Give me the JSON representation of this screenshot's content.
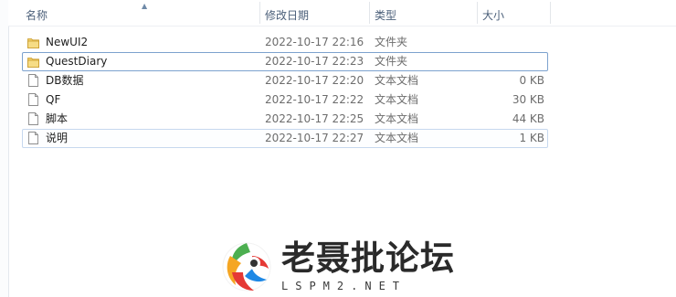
{
  "header": {
    "col_name": "名称",
    "col_date": "修改日期",
    "col_type": "类型",
    "col_size": "大小"
  },
  "files": [
    {
      "name": "NewUI2",
      "date": "2022-10-17 22:16",
      "type": "文件夹",
      "size": "",
      "icon": "folder-icon"
    },
    {
      "name": "QuestDiary",
      "date": "2022-10-17 22:23",
      "type": "文件夹",
      "size": "",
      "icon": "folder-icon"
    },
    {
      "name": "DB数据",
      "date": "2022-10-17 22:20",
      "type": "文本文档",
      "size": "0 KB",
      "icon": "text-document-icon"
    },
    {
      "name": "QF",
      "date": "2022-10-17 22:22",
      "type": "文本文档",
      "size": "30 KB",
      "icon": "text-document-icon"
    },
    {
      "name": "脚本",
      "date": "2022-10-17 22:25",
      "type": "文本文档",
      "size": "44 KB",
      "icon": "text-document-icon"
    },
    {
      "name": "说明",
      "date": "2022-10-17 22:27",
      "type": "文本文档",
      "size": "1 KB",
      "icon": "text-document-icon"
    }
  ],
  "watermark": {
    "text": "老聂批论坛",
    "sub": "LSPM2.NET"
  },
  "colors": {
    "header_text": "#4c607a",
    "focus_border": "#7da2ce",
    "folder": "#e8c15a"
  }
}
